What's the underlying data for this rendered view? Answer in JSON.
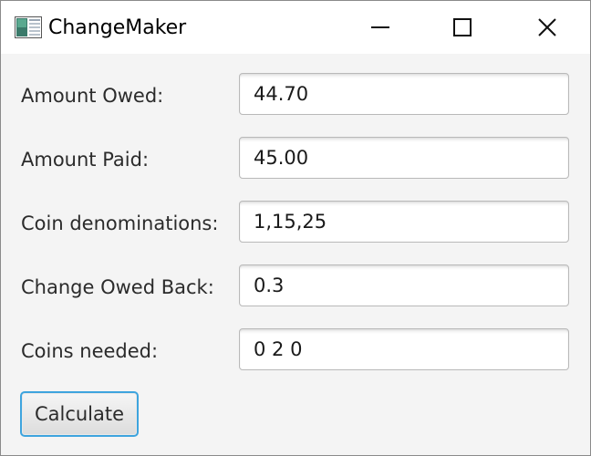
{
  "window": {
    "title": "ChangeMaker",
    "icon": "app-window-icon",
    "controls": {
      "minimize_icon": "minimize-icon",
      "maximize_icon": "maximize-icon",
      "close_icon": "close-icon"
    }
  },
  "form": {
    "amount_owed": {
      "label": "Amount Owed:",
      "value": "44.70"
    },
    "amount_paid": {
      "label": "Amount Paid:",
      "value": "45.00"
    },
    "coin_denominations": {
      "label": "Coin denominations:",
      "value": "1,15,25"
    },
    "change_owed_back": {
      "label": "Change Owed Back:",
      "value": "0.3"
    },
    "coins_needed": {
      "label": "Coins needed:",
      "value": "0 2 0"
    }
  },
  "actions": {
    "calculate_label": "Calculate"
  },
  "colors": {
    "focus_accent": "#3ea4de",
    "window_background": "#f4f4f4",
    "titlebar_background": "#ffffff"
  }
}
